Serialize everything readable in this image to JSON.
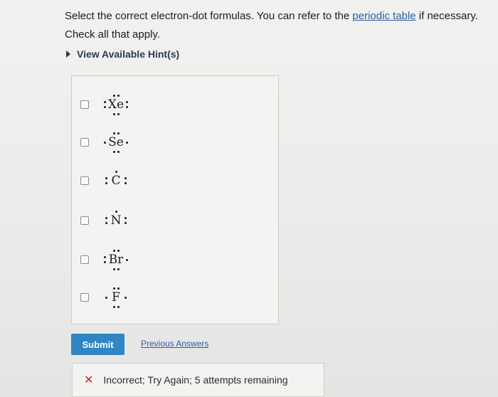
{
  "question": {
    "line1_pre": "Select the correct electron-dot formulas. You can refer to the ",
    "line1_link": "periodic table",
    "line1_post": " if necessary.",
    "line2": "Check all that apply."
  },
  "hints": {
    "label": "View Available Hint(s)"
  },
  "choices": [
    {
      "symbol": "Xe",
      "checked": false,
      "dots": "8 dots (pairs top, left, right, bottom)"
    },
    {
      "symbol": "Se",
      "checked": false,
      "dots": "6 dots (pairs top, bottom; single left, right)"
    },
    {
      "symbol": "C",
      "checked": false,
      "dots": "5 dots (single top; pairs left, right)"
    },
    {
      "symbol": "N",
      "checked": false,
      "dots": "5 dots (single top; pair left; single right)"
    },
    {
      "symbol": "Br",
      "checked": false,
      "dots": "7 dots (pairs top, left, bottom; single right)"
    },
    {
      "symbol": "F",
      "checked": false,
      "dots": "7 dots (pairs top, bottom; singles left, right)"
    }
  ],
  "actions": {
    "submit_label": "Submit",
    "previous_answers_label": "Previous Answers"
  },
  "feedback": {
    "icon": "x-icon",
    "text": "Incorrect; Try Again; 5 attempts remaining",
    "icon_color": "#c0262d"
  },
  "colors": {
    "accent": "#2f86c4",
    "link": "#2a5fa6"
  }
}
